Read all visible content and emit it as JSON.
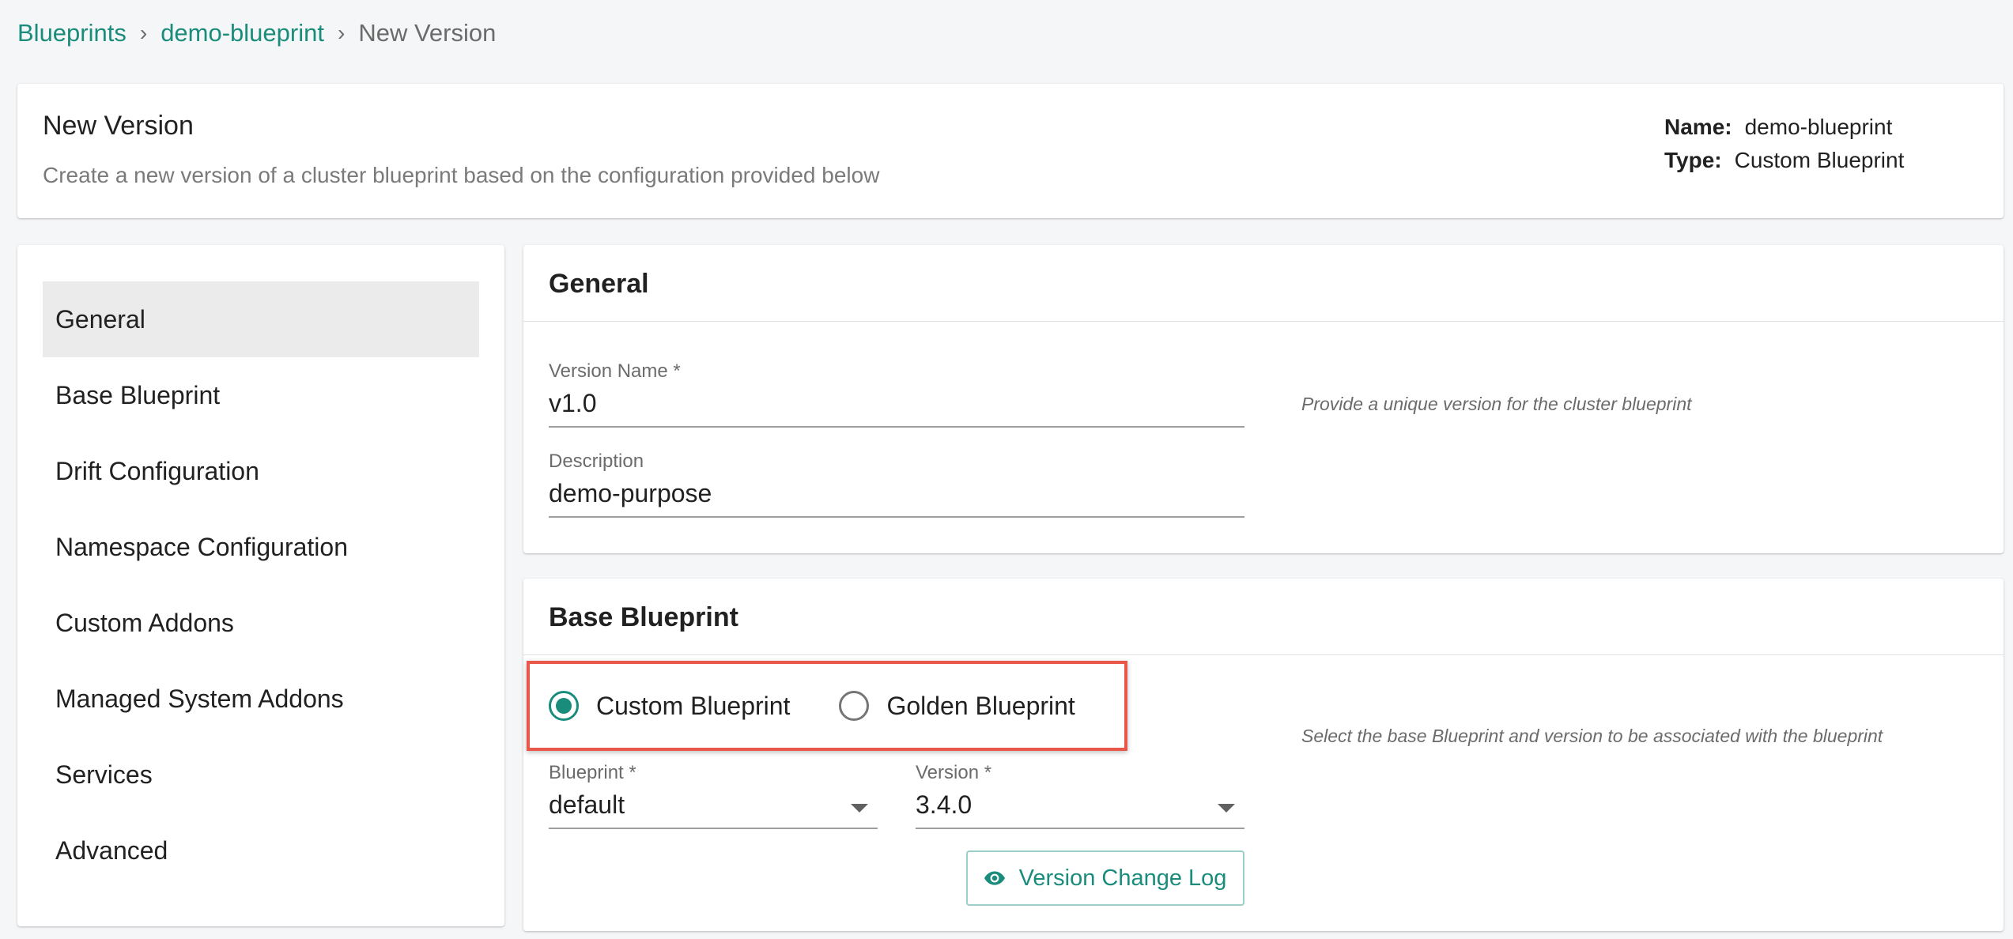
{
  "breadcrumb": {
    "items": [
      "Blueprints",
      "demo-blueprint"
    ],
    "current": "New Version",
    "separator": "›"
  },
  "header": {
    "title": "New Version",
    "subtitle": "Create a new version of a cluster blueprint based on the configuration provided below",
    "name_label": "Name:",
    "name_value": "demo-blueprint",
    "type_label": "Type:",
    "type_value": "Custom Blueprint"
  },
  "sidebar": {
    "items": [
      {
        "label": "General"
      },
      {
        "label": "Base Blueprint"
      },
      {
        "label": "Drift Configuration"
      },
      {
        "label": "Namespace Configuration"
      },
      {
        "label": "Custom Addons"
      },
      {
        "label": "Managed System Addons"
      },
      {
        "label": "Services"
      },
      {
        "label": "Advanced"
      }
    ]
  },
  "general": {
    "title": "General",
    "version_name_label": "Version Name *",
    "version_name_value": "v1.0",
    "description_label": "Description",
    "description_value": "demo-purpose",
    "hint": "Provide a unique version for the cluster blueprint"
  },
  "base_blueprint": {
    "title": "Base Blueprint",
    "radio_options": [
      {
        "label": "Custom Blueprint"
      },
      {
        "label": "Golden Blueprint"
      }
    ],
    "blueprint_label": "Blueprint *",
    "blueprint_value": "default",
    "version_label": "Version *",
    "version_value": "3.4.0",
    "hint": "Select the base Blueprint and version to be associated with the blueprint",
    "change_log_button": "Version Change Log"
  },
  "colors": {
    "accent": "#1a8c7c",
    "highlight_border": "#e8574a"
  }
}
